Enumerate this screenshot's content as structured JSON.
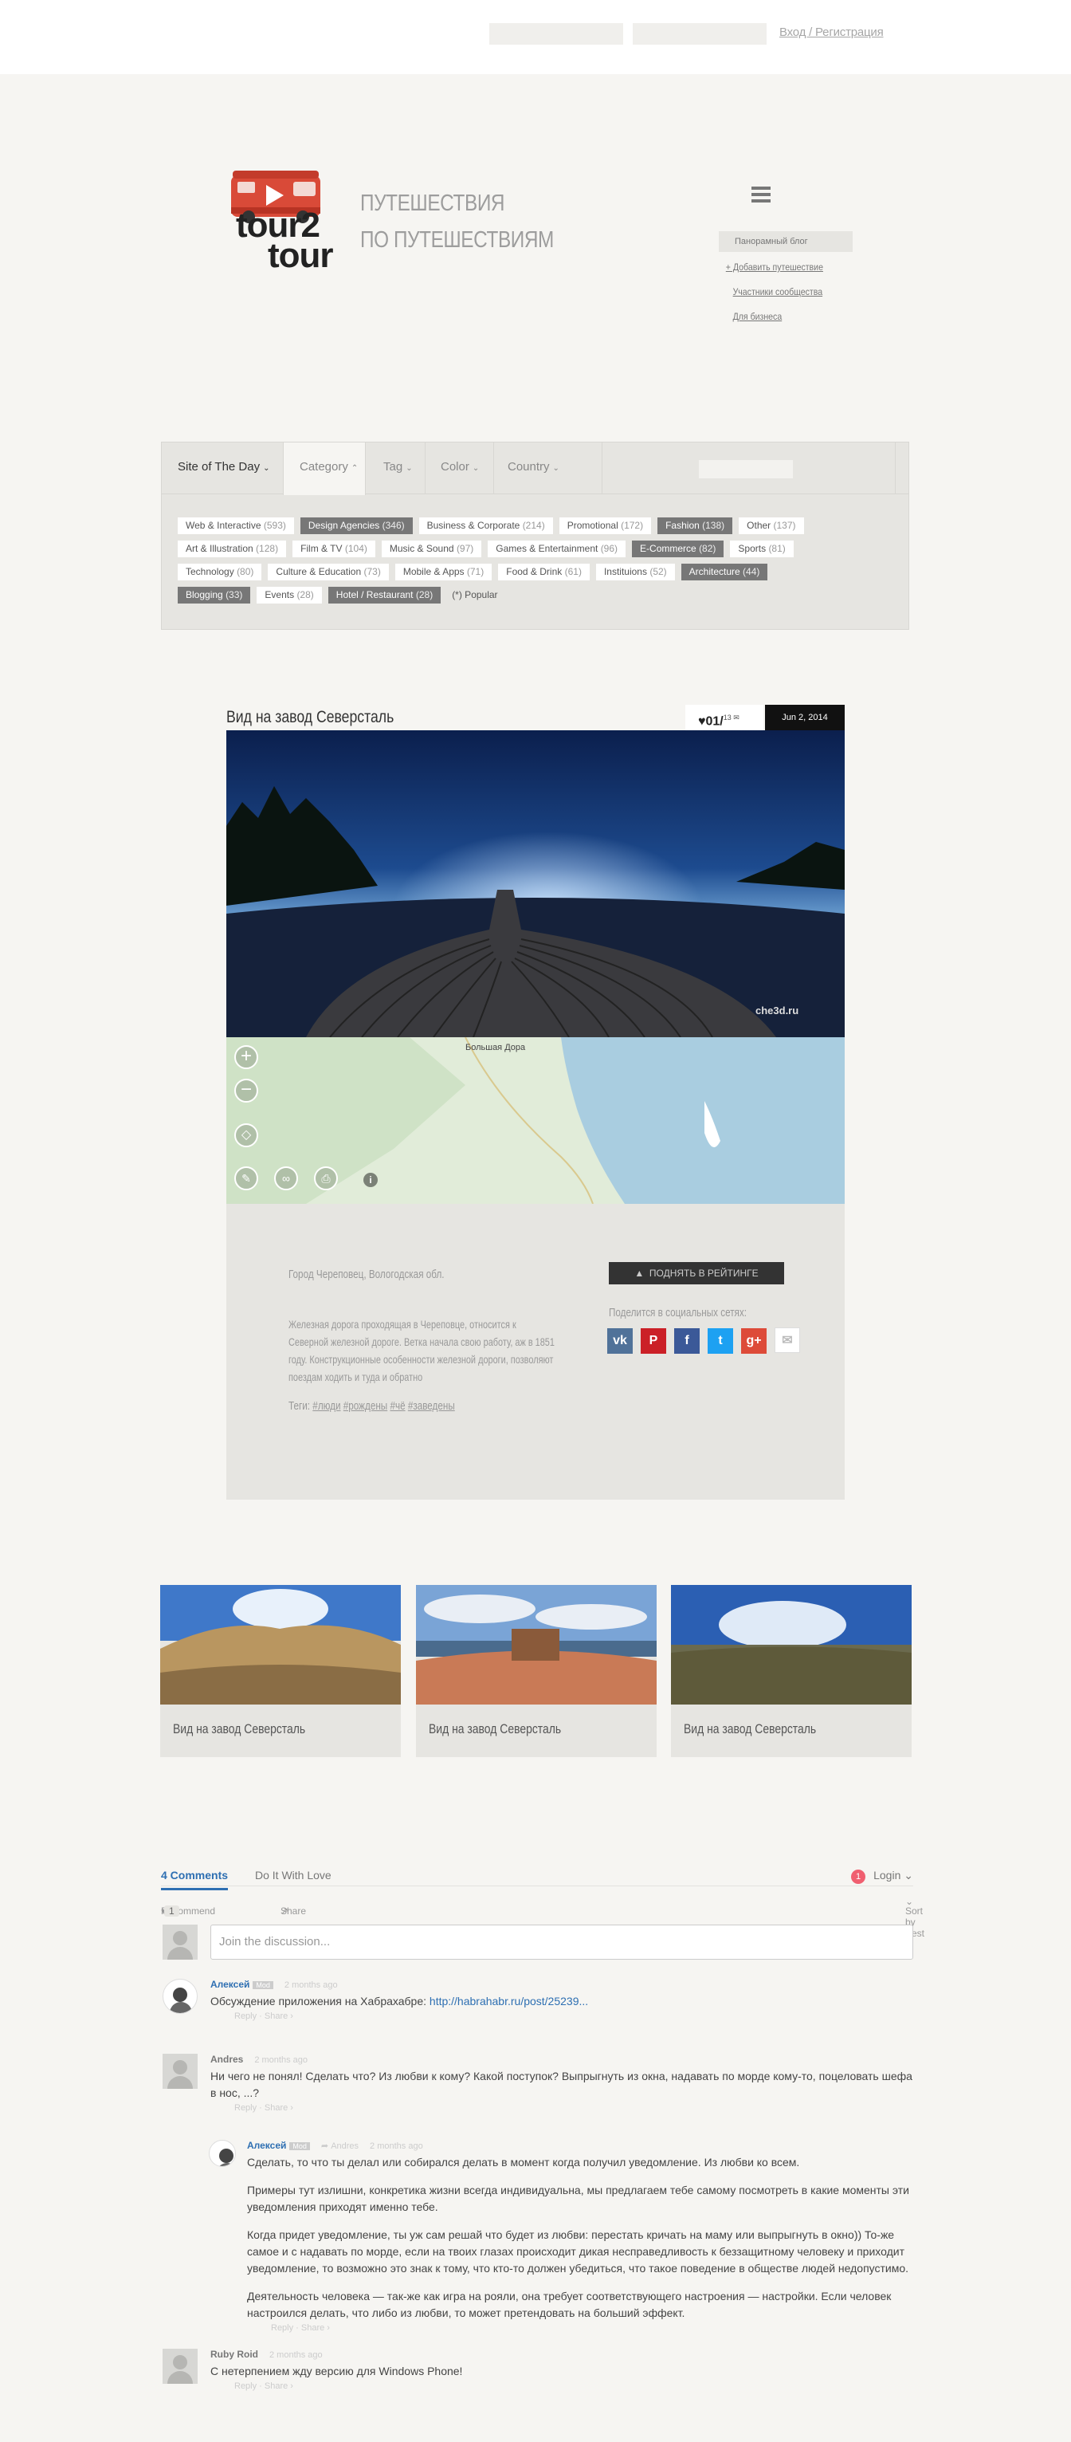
{
  "topbar": {
    "login": "Вход / Регистрация"
  },
  "header": {
    "logo_line1": "tour2",
    "logo_line2": "tour",
    "tagline_1": "ПУТЕШЕСТВИЯ",
    "tagline_2": "ПО ПУТЕШЕСТВИЯМ",
    "menu": [
      {
        "label": "Панорамный блог"
      },
      {
        "label": "+ Добавить путешествие"
      },
      {
        "label": "Участники сообщества"
      },
      {
        "label": "Для бизнеса"
      }
    ]
  },
  "filter": {
    "tabs": [
      "Site of The Day",
      "Category",
      "Tag",
      "Color",
      "Country"
    ],
    "rows": [
      [
        {
          "label": "Web & Interactive",
          "count": "(593)",
          "on": false
        },
        {
          "label": "Design Agencies",
          "count": "(346)",
          "on": true
        },
        {
          "label": "Business & Corporate",
          "count": "(214)",
          "on": false
        },
        {
          "label": "Promotional",
          "count": "(172)",
          "on": false
        },
        {
          "label": "Fashion",
          "count": "(138)",
          "on": true
        },
        {
          "label": "Other",
          "count": "(137)",
          "on": false
        }
      ],
      [
        {
          "label": "Art & Illustration",
          "count": "(128)",
          "on": false
        },
        {
          "label": "Film & TV",
          "count": "(104)",
          "on": false
        },
        {
          "label": "Music & Sound",
          "count": "(97)",
          "on": false
        },
        {
          "label": "Games & Entertainment",
          "count": "(96)",
          "on": false
        },
        {
          "label": "E-Commerce",
          "count": "(82)",
          "on": true
        },
        {
          "label": "Sports",
          "count": "(81)",
          "on": false
        }
      ],
      [
        {
          "label": "Technology",
          "count": "(80)",
          "on": false
        },
        {
          "label": "Culture & Education",
          "count": "(73)",
          "on": false
        },
        {
          "label": "Mobile & Apps",
          "count": "(71)",
          "on": false
        },
        {
          "label": "Food & Drink",
          "count": "(61)",
          "on": false
        },
        {
          "label": "Instituions",
          "count": "(52)",
          "on": false
        },
        {
          "label": "Architecture",
          "count": "(44)",
          "on": true
        }
      ],
      [
        {
          "label": "Blogging",
          "count": "(33)",
          "on": true
        },
        {
          "label": "Events",
          "count": "(28)",
          "on": false
        },
        {
          "label": "Hotel / Restaurant",
          "count": "(28)",
          "on": true
        },
        {
          "label": "(*) Popular",
          "count": "",
          "on": false,
          "plain": true
        }
      ]
    ]
  },
  "post": {
    "title": "Вид на завод Северсталь",
    "likes": "01/",
    "comments": "13",
    "date": "Jun 2, 2014",
    "watermark": "che3d.ru",
    "map_label": "Большая Дора",
    "city": "Город Череповец, Вологодская обл.",
    "description": "Железная дорога проходящая в Череповце, относится к Северной железной дороге. Ветка начала свою работу, аж в 1851 году. Конструкционные особенности железной дороги, позволяют поездам ходить и туда и обратно",
    "tags_label": "Теги:",
    "tags": [
      "#люди",
      "#рождены",
      "#чё",
      "#заведены"
    ],
    "rate_button": "ПОДНЯТЬ В РЕЙТИНГЕ",
    "share_label": "Поделится в социальных сетях:",
    "socials": [
      {
        "name": "vk",
        "glyph": "vk",
        "color": "#507299"
      },
      {
        "name": "pinterest",
        "glyph": "P",
        "color": "#cb2027"
      },
      {
        "name": "facebook",
        "glyph": "f",
        "color": "#3b5998"
      },
      {
        "name": "twitter",
        "glyph": "t",
        "color": "#1da1f2"
      },
      {
        "name": "google-plus",
        "glyph": "g+",
        "color": "#dd4b39"
      },
      {
        "name": "email",
        "glyph": "✉",
        "color": "#ffffff"
      }
    ]
  },
  "related": [
    {
      "caption": "Вид на завод Северсталь"
    },
    {
      "caption": "Вид на завод Северсталь"
    },
    {
      "caption": "Вид на завод Северсталь"
    }
  ],
  "disqus": {
    "tab_comments": "4 Comments",
    "tab_site": "Do It With Love",
    "badge": "1",
    "login": "Login",
    "recommend": "Recommend",
    "recommend_count": "1",
    "share": "Share",
    "sort": "Sort by Best",
    "placeholder": "Join the discussion...",
    "comments": [
      {
        "author": "Алексей",
        "mod": "Mod",
        "time": "2 months ago",
        "paras": [
          "Обсуждение приложения на Хабрахабре: "
        ],
        "link": "http://habrahabr.ru/post/25239...",
        "acts": "Reply · Share ›"
      },
      {
        "author": "Andres",
        "time": "2 months ago",
        "paras": [
          "Ни чего не понял! Сделать что? Из любви к кому? Какой поступок? Выпрыгнуть из окна, надавать по морде кому-то, поцеловать шефа в нос, ...?"
        ],
        "acts": "Reply · Share ›"
      },
      {
        "author": "Алексей",
        "mod": "Mod",
        "reply_to": "Andres",
        "time": "2 months ago",
        "paras": [
          "Сделать, то что ты делал или собирался делать в момент когда получил уведомление. Из любви ко всем.",
          "Примеры тут излишни, конкретика жизни всегда индивидуальна, мы предлагаем тебе самому посмотреть в какие моменты эти уведомления приходят именно тебе.",
          "Когда придет уведомление, ты уж сам решай что будет из любви: перестать кричать на маму или выпрыгнуть в окно)) То-же самое и с надавать по морде, если на твоих глазах происходит дикая несправедливость к беззащитному человеку и приходит уведомление, то возможно это знак к тому, что кто-то должен убедиться, что такое поведение в обществе людей недопустимо.",
          "Деятельность человека — так-же как игра на рояли, она требует соответствующего настроения — настройки. Если человек настроился делать, что либо из любви, то может претендовать на больший эффект."
        ],
        "acts": "Reply · Share ›"
      },
      {
        "author": "Ruby Roid",
        "time": "2 months ago",
        "paras": [
          "С нетерпением жду версию для Windows Phone!"
        ],
        "acts": "Reply · Share ›"
      }
    ]
  }
}
